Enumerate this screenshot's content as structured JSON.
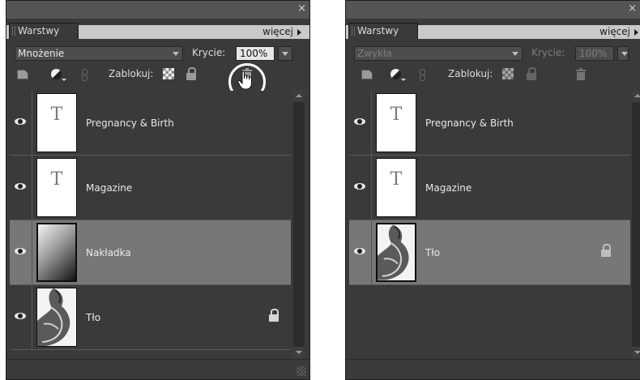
{
  "panels": [
    {
      "tab_label": "Warstwy",
      "more_label": "więcej",
      "blend_mode": "Mnożenie",
      "opacity_label": "Krycie:",
      "opacity_value": "100%",
      "lock_label": "Zablokuj:",
      "close_glyph": "×",
      "layers": [
        {
          "name": "Pregnancy & Birth",
          "thumb": "text",
          "thumb_glyph": "T",
          "selected": false,
          "locked": false
        },
        {
          "name": "Magazine",
          "thumb": "text",
          "thumb_glyph": "T",
          "selected": false,
          "locked": false
        },
        {
          "name": "Nakładka",
          "thumb": "gradient",
          "selected": true,
          "locked": false
        },
        {
          "name": "Tło",
          "thumb": "photo",
          "selected": false,
          "locked": true
        }
      ]
    },
    {
      "tab_label": "Warstwy",
      "more_label": "więcej",
      "blend_mode": "Zwykła",
      "opacity_label": "Krycie:",
      "opacity_value": "100%",
      "lock_label": "Zablokuj:",
      "close_glyph": "×",
      "layers": [
        {
          "name": "Pregnancy & Birth",
          "thumb": "text",
          "thumb_glyph": "T",
          "selected": false,
          "locked": false
        },
        {
          "name": "Magazine",
          "thumb": "text",
          "thumb_glyph": "T",
          "selected": false,
          "locked": false
        },
        {
          "name": "Tło",
          "thumb": "photo",
          "selected": true,
          "locked": true
        }
      ]
    }
  ],
  "icons": {
    "visibility": "eye-icon",
    "new_layer": "new-layer-icon",
    "adjustment": "adjustment-layer-icon",
    "link": "link-icon",
    "lock_transparency": "checkerboard-lock-icon",
    "lock_all": "lock-icon",
    "delete": "trash-icon",
    "cursor": "hand-pointer-icon"
  },
  "colors": {
    "panel_bg": "#3a3a3a",
    "selected_row": "#777777",
    "tab_strip": "#c9c9c9",
    "highlight_ring": "#ffffff"
  }
}
